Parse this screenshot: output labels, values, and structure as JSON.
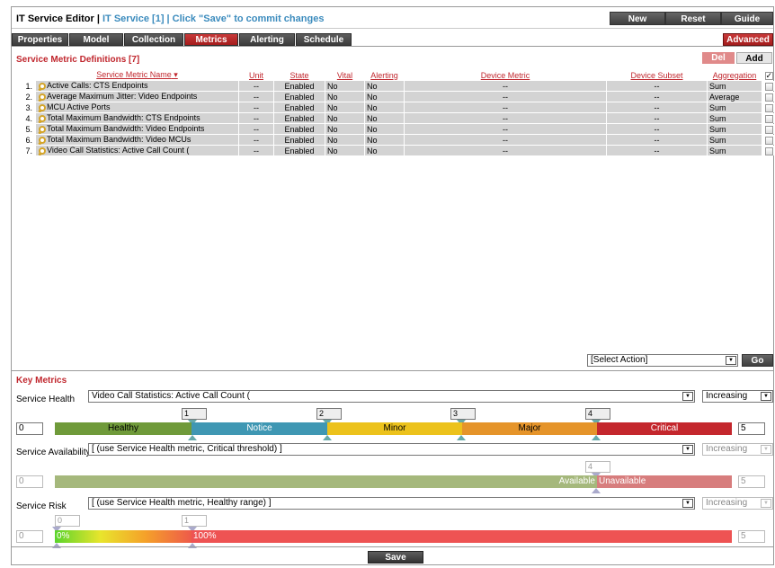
{
  "header": {
    "title_main": "IT Service Editor | ",
    "title_sub": "IT Service [1] | Click \"Save\" to commit changes",
    "buttons": {
      "new": "New",
      "reset": "Reset",
      "guide": "Guide"
    }
  },
  "tabs": [
    "Properties",
    "Model",
    "Collection",
    "Metrics",
    "Alerting",
    "Schedule"
  ],
  "active_tab": "Metrics",
  "advanced_label": "Advanced",
  "definitions": {
    "title": "Service Metric Definitions [7]",
    "del_label": "Del",
    "add_label": "Add",
    "columns": [
      "Service Metric Name",
      "Unit",
      "State",
      "Vital",
      "Alerting",
      "Device Metric",
      "Device Subset",
      "Aggregation"
    ],
    "rows": [
      {
        "idx": "1.",
        "name": "Active Calls: CTS Endpoints",
        "unit": "--",
        "state": "Enabled",
        "vital": "No",
        "alerting": "No",
        "device_metric": "--",
        "device_subset": "--",
        "aggregation": "Sum"
      },
      {
        "idx": "2.",
        "name": "Average Maximum Jitter: Video Endpoints",
        "unit": "--",
        "state": "Enabled",
        "vital": "No",
        "alerting": "No",
        "device_metric": "--",
        "device_subset": "--",
        "aggregation": "Average"
      },
      {
        "idx": "3.",
        "name": "MCU Active Ports",
        "unit": "--",
        "state": "Enabled",
        "vital": "No",
        "alerting": "No",
        "device_metric": "--",
        "device_subset": "--",
        "aggregation": "Sum"
      },
      {
        "idx": "4.",
        "name": "Total Maximum Bandwidth: CTS Endpoints",
        "unit": "--",
        "state": "Enabled",
        "vital": "No",
        "alerting": "No",
        "device_metric": "--",
        "device_subset": "--",
        "aggregation": "Sum"
      },
      {
        "idx": "5.",
        "name": "Total Maximum Bandwidth: Video Endpoints",
        "unit": "--",
        "state": "Enabled",
        "vital": "No",
        "alerting": "No",
        "device_metric": "--",
        "device_subset": "--",
        "aggregation": "Sum"
      },
      {
        "idx": "6.",
        "name": "Total Maximum Bandwidth: Video MCUs",
        "unit": "--",
        "state": "Enabled",
        "vital": "No",
        "alerting": "No",
        "device_metric": "--",
        "device_subset": "--",
        "aggregation": "Sum"
      },
      {
        "idx": "7.",
        "name": "Video Call Statistics: Active Call Count (",
        "unit": "--",
        "state": "Enabled",
        "vital": "No",
        "alerting": "No",
        "device_metric": "--",
        "device_subset": "--",
        "aggregation": "Sum"
      }
    ],
    "select_action": "[Select Action]",
    "go_label": "Go"
  },
  "key_metrics": {
    "title": "Key Metrics",
    "health": {
      "label": "Service Health",
      "metric": "Video Call Statistics: Active Call Count (",
      "direction": "Increasing",
      "min": "0",
      "max": "5",
      "thresholds": [
        "1",
        "2",
        "3",
        "4"
      ],
      "bands": [
        "Healthy",
        "Notice",
        "Minor",
        "Major",
        "Critical"
      ]
    },
    "availability": {
      "label": "Service Availability",
      "metric": "[ (use Service Health metric, Critical threshold) ]",
      "direction": "Increasing",
      "min": "0",
      "max": "5",
      "threshold": "4",
      "available_label": "Available",
      "unavailable_label": "Unavailable"
    },
    "risk": {
      "label": "Service Risk",
      "metric": "[ (use Service Health metric, Healthy range) ]",
      "direction": "Increasing",
      "min": "0",
      "max": "5",
      "markers": [
        "0",
        "1"
      ],
      "low_label": "0%",
      "high_label": "100%"
    }
  },
  "save_label": "Save"
}
